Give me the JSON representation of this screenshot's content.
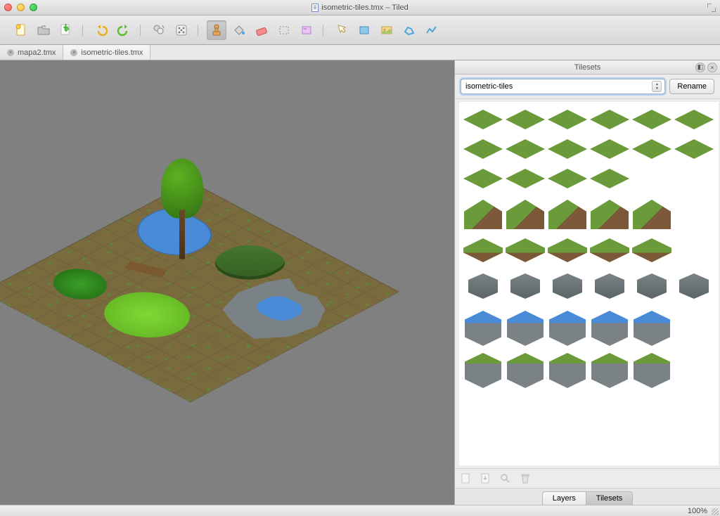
{
  "window": {
    "title": "isometric-tiles.tmx – Tiled"
  },
  "tabs": [
    {
      "name": "mapa2.tmx"
    },
    {
      "name": "isometric-tiles.tmx"
    }
  ],
  "active_tab_index": 1,
  "toolbar": {
    "new": "New",
    "open": "Open",
    "save": "Save",
    "undo": "Undo",
    "redo": "Redo",
    "cmd": "Command",
    "random": "Random",
    "stamp": "Stamp Brush",
    "fill": "Bucket Fill",
    "eraser": "Eraser",
    "rect": "Rectangle Select",
    "wand": "Magic Wand",
    "objsel": "Select Objects",
    "insrect": "Insert Rectangle",
    "insimg": "Insert Tile",
    "polygon": "Insert Polygon",
    "polyline": "Insert Polyline"
  },
  "canvas": {
    "map_features": [
      "water",
      "hill",
      "rocks",
      "bush",
      "grass",
      "log",
      "tree"
    ]
  },
  "panel": {
    "title": "Tilesets",
    "dropdown_value": "isometric-tiles",
    "rename_label": "Rename",
    "bottom_tools": [
      "new-tileset",
      "import",
      "zoom",
      "delete"
    ],
    "tabs": {
      "layers": "Layers",
      "tilesets": "Tilesets"
    },
    "active_tab": "tilesets"
  },
  "tileset": {
    "rows": [
      {
        "kind": "diamond",
        "count": 6
      },
      {
        "kind": "diamond",
        "count": 6
      },
      {
        "kind": "diamond",
        "count": 4
      },
      {
        "kind": "slope",
        "count": 5
      },
      {
        "kind": "earth",
        "count": 5
      },
      {
        "kind": "rock-sm",
        "count": 6
      },
      {
        "kind": "water-blk",
        "count": 5
      },
      {
        "kind": "grass-blk",
        "count": 5
      }
    ]
  },
  "status": {
    "zoom": "100%"
  }
}
